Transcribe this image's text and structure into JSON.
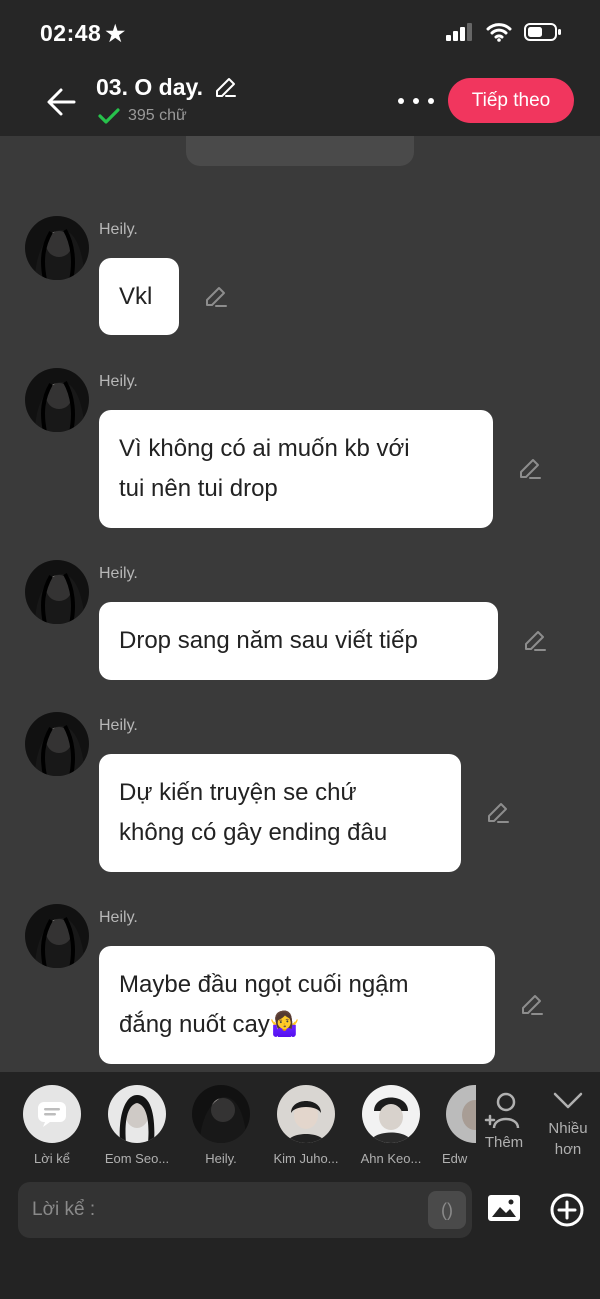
{
  "status_bar": {
    "time": "02:48",
    "star": "★"
  },
  "header": {
    "title": "03. O day.",
    "word_count": "395 chữ",
    "next_label": "Tiếp theo"
  },
  "messages": [
    {
      "sender": "Heily.",
      "text": "Vkl"
    },
    {
      "sender": "Heily.",
      "text": "Vì không có ai muốn kb với\ntui nên tui drop"
    },
    {
      "sender": "Heily.",
      "text": "Drop sang năm sau viết tiếp"
    },
    {
      "sender": "Heily.",
      "text": "Dự kiến truyện se chứ\nkhông có gây ending đâu"
    },
    {
      "sender": "Heily.",
      "text": "Maybe đầu ngọt cuối ngậm\nđắng nuốt cay🤷‍♀️"
    }
  ],
  "characters": [
    {
      "name": "Lời kể"
    },
    {
      "name": "Eom Seo..."
    },
    {
      "name": "Heily."
    },
    {
      "name": "Kim Juho..."
    },
    {
      "name": "Ahn Keo..."
    },
    {
      "name": "Edw"
    }
  ],
  "character_actions": {
    "add_label": "Thêm",
    "more_label": "Nhiều\nhơn"
  },
  "input": {
    "placeholder": "Lời kể :",
    "paren_label": "()"
  },
  "colors": {
    "accent": "#f1365e",
    "check": "#27c24c",
    "background": "#3a3a3a"
  }
}
